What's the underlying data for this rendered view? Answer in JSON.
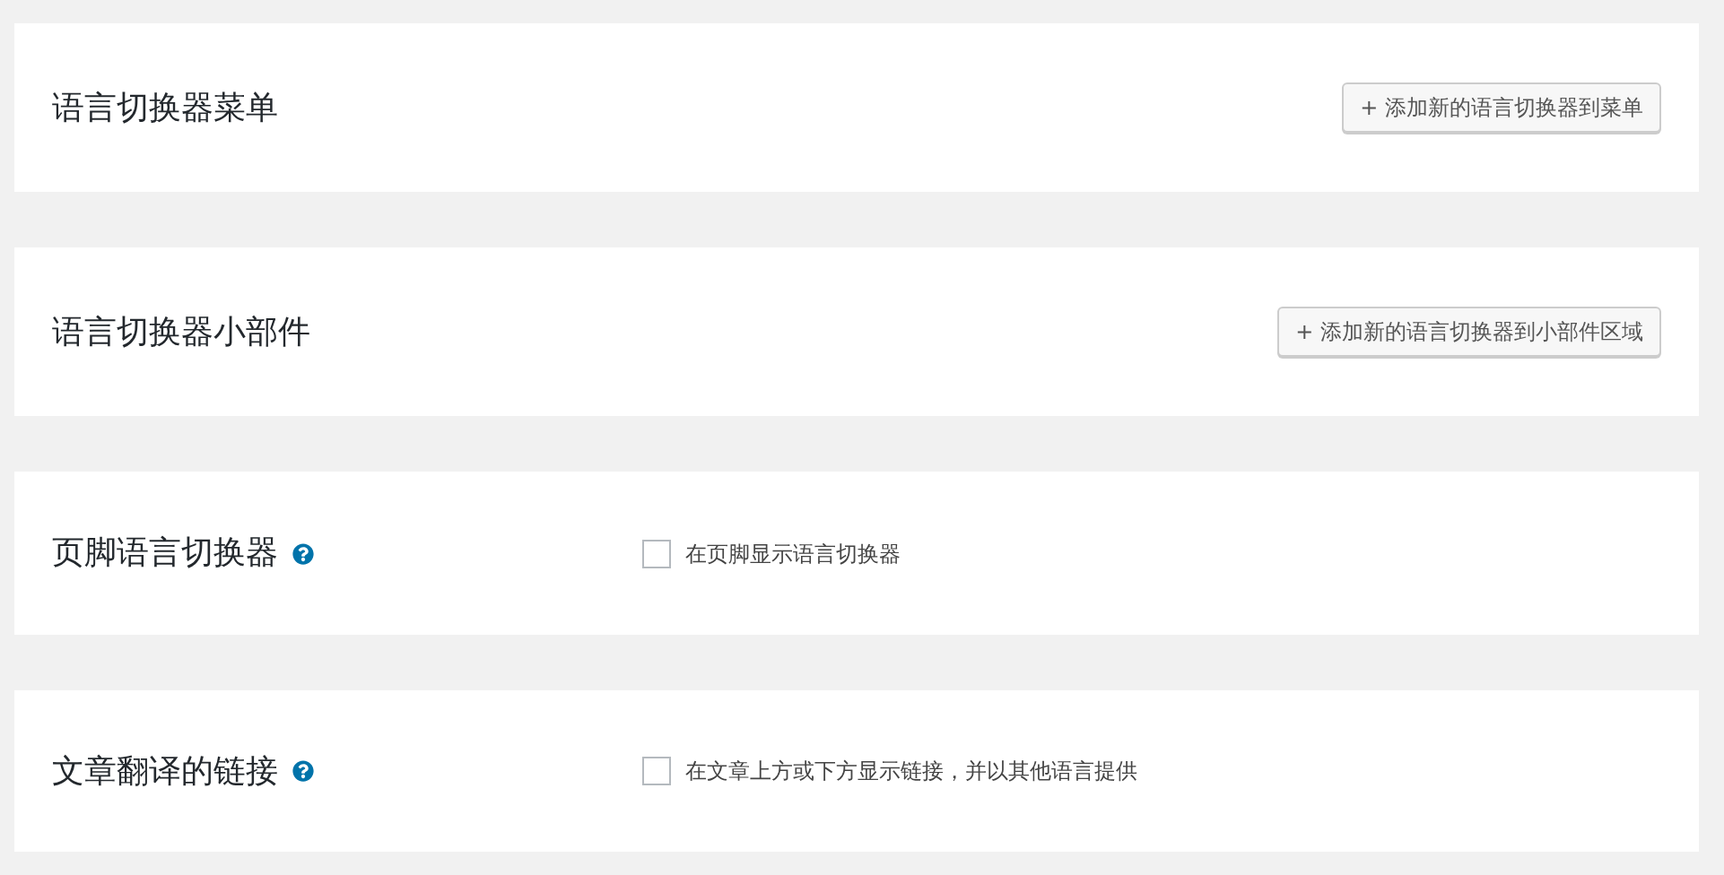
{
  "sections": [
    {
      "kind": "button",
      "title": "语言切换器菜单",
      "button": "+ 添加新的语言切换器到菜单"
    },
    {
      "kind": "button",
      "title": "语言切换器小部件",
      "button": "+ 添加新的语言切换器到小部件区域"
    },
    {
      "kind": "checkbox",
      "title": "页脚语言切换器",
      "help": true,
      "label": "在页脚显示语言切换器",
      "checked": false
    },
    {
      "kind": "checkbox",
      "title": "文章翻译的链接",
      "help": true,
      "label": "在文章上方或下方显示链接，并以其他语言提供",
      "checked": false
    }
  ]
}
